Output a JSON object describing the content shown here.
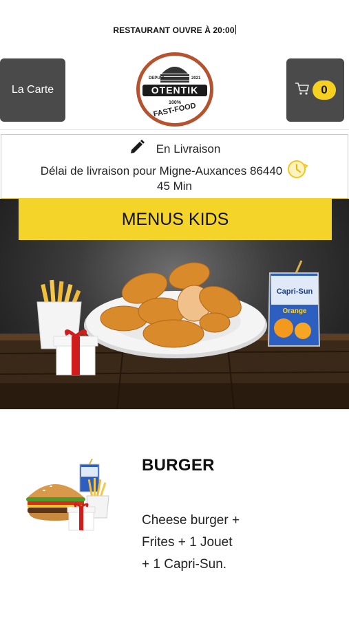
{
  "status": {
    "text": "RESTAURANT OUVRE À 20:00"
  },
  "header": {
    "menu_button_label": "La Carte",
    "logo": {
      "brand_name": "OTENTIK",
      "depuis_label": "DEPUIS",
      "year": "2021",
      "percent": "100%",
      "tagline": "FAST-FOOD"
    },
    "cart": {
      "count": "0"
    }
  },
  "delivery": {
    "mode_label": "En Livraison",
    "delay_text": "Délai de livraison pour Migne-Auxances 86440",
    "duration": "45 Min"
  },
  "banner": {
    "title": "MENUS KIDS",
    "drink_brand": "Capri-Sun",
    "drink_flavor": "Orange"
  },
  "menu_item": {
    "title": "BURGER",
    "description_lines": [
      "Cheese burger  +",
      "Frites  + 1 Jouet",
      "+ 1 Capri-Sun."
    ]
  },
  "colors": {
    "accent_yellow": "#f5d42a",
    "button_gray": "#4a4a4a",
    "logo_ring": "#b5532f"
  },
  "icons": [
    "shopping-cart-icon",
    "pencil-icon",
    "clock-icon"
  ]
}
